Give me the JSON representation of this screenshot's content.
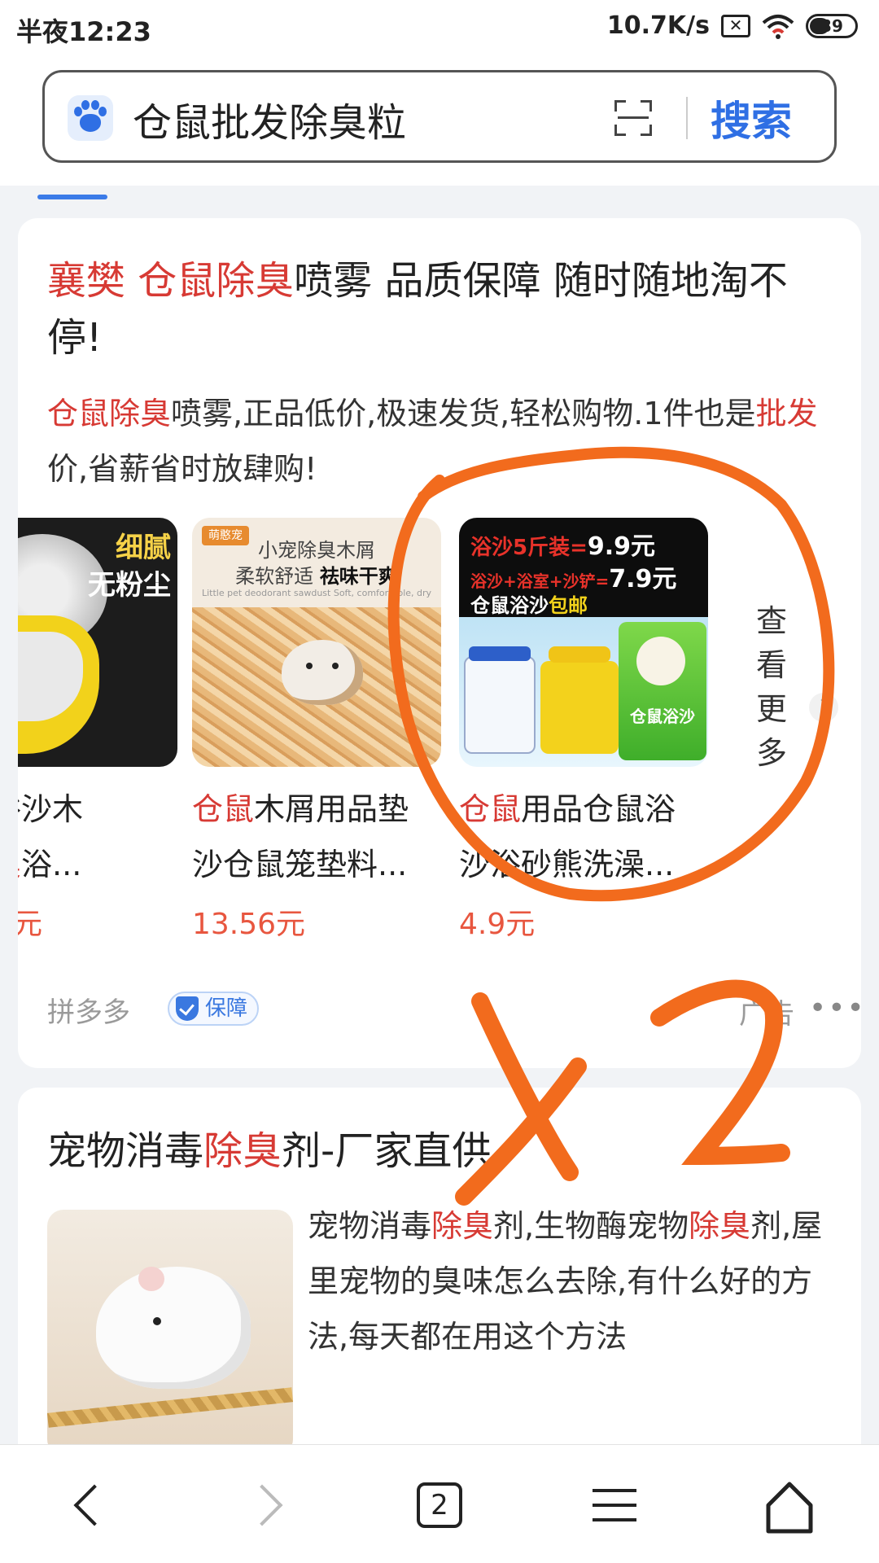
{
  "status_bar": {
    "time": "半夜12:23",
    "speed": "10.7K/s",
    "battery": "39"
  },
  "search": {
    "query": "仓鼠批发除臭粒",
    "button": "搜索"
  },
  "ad_card": {
    "title": [
      "襄樊",
      " ",
      "仓鼠除臭",
      "喷雾 品质保障 随时随地淘不停!"
    ],
    "desc": [
      "仓鼠除臭",
      "喷雾,正品低价,极速发货,轻松购物.1件也是",
      "批发",
      "价,省薪省时放肆购!"
    ],
    "products": [
      {
        "name_line1": "萌装浴沙木",
        "name_line2_pre": "屑",
        "name_line2_red": "除臭",
        "name_line2_post": "浴...",
        "price": "元",
        "thumb": {
          "line1": "细腻",
          "line2": "无粉尘"
        }
      },
      {
        "name_red": "仓鼠",
        "name_line1_post": "木屑用品垫",
        "name_line2": "沙仓鼠笼垫料...",
        "price": "13.56元",
        "thumb": {
          "brand": "萌憨宠",
          "line1": "小宠除臭木屑",
          "line2a": "柔软舒适 ",
          "line2b": "祛味干爽",
          "line3": "Little pet deodorant sawdust  Soft, comfortable, dry"
        }
      },
      {
        "name_red": "仓鼠",
        "name_line1_post": "用品仓鼠浴",
        "name_line2": "沙浴砂熊洗澡...",
        "price": "4.9元",
        "thumb": {
          "l1": "浴沙5斤装=",
          "l1v": "9.9元",
          "l2": "浴沙+浴室+沙铲=",
          "l2v": "7.9元",
          "l3a": "仓鼠浴沙",
          "l3b": "包邮",
          "bag": "仓鼠浴沙"
        }
      }
    ],
    "more": [
      "查",
      "看",
      "更",
      "多"
    ],
    "source": "拼多多",
    "guarantee": "保障",
    "ad_label": "广告",
    "more_dots": "•••"
  },
  "card2": {
    "title": [
      "宠物消毒",
      "除臭",
      "剂-厂家直供"
    ],
    "desc": [
      "宠物消毒",
      "除臭",
      "剂,生物酶宠物",
      "除臭",
      "剂,屋里宠物的臭味怎么去除,有什么好的方法,每天都在用这个方法"
    ]
  },
  "annotation": {
    "color": "#f26b1d",
    "text": "x2"
  },
  "bottom_nav": {
    "tabs_count": "2"
  }
}
